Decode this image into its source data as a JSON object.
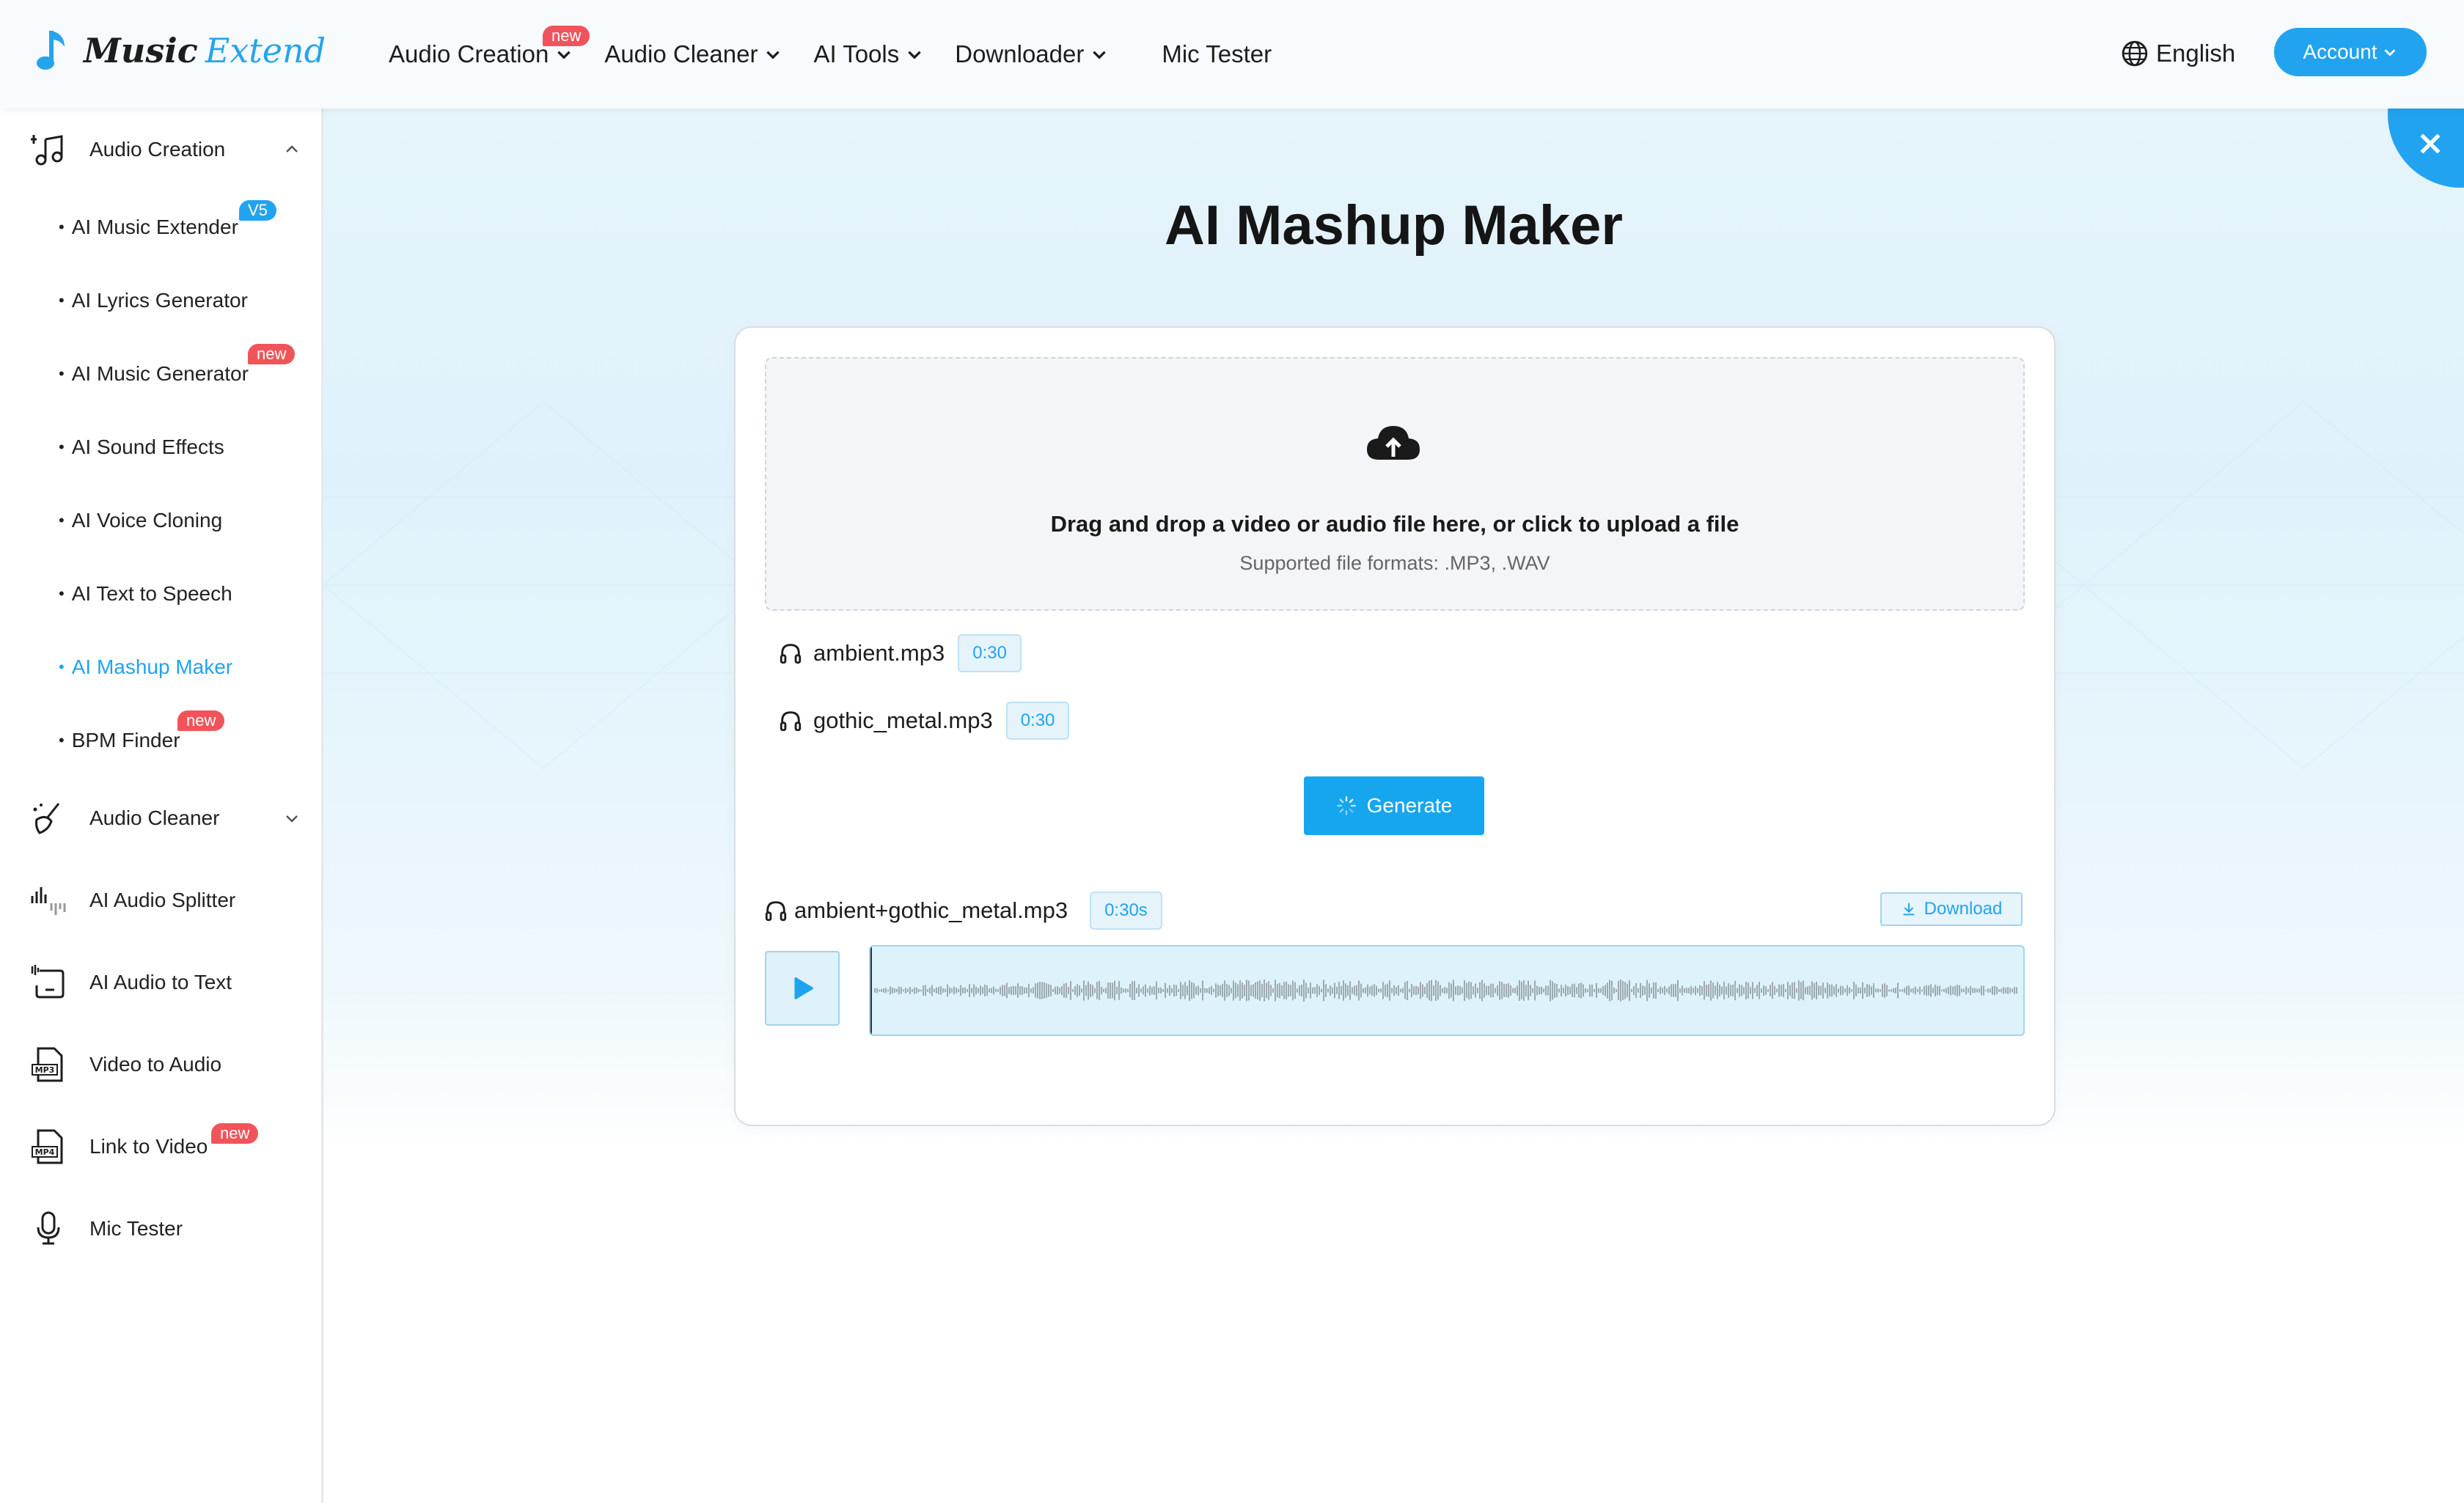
{
  "logo": {
    "word1": "Music",
    "word2": "Extend"
  },
  "nav": {
    "items": [
      {
        "label": "Audio Creation",
        "badge": "new"
      },
      {
        "label": "Audio Cleaner"
      },
      {
        "label": "AI Tools"
      },
      {
        "label": "Downloader"
      }
    ],
    "mic_tester": "Mic Tester",
    "language": "English",
    "account": "Account"
  },
  "sidebar": {
    "audio_creation": "Audio Creation",
    "sub_items": [
      {
        "label": "AI Music Extender",
        "badge": "V5"
      },
      {
        "label": "AI Lyrics Generator"
      },
      {
        "label": "AI Music Generator",
        "badge": "new"
      },
      {
        "label": "AI Sound Effects"
      },
      {
        "label": "AI Voice Cloning"
      },
      {
        "label": "AI Text to Speech"
      },
      {
        "label": "AI Mashup Maker",
        "active": true
      },
      {
        "label": "BPM Finder",
        "badge": "new"
      }
    ],
    "audio_cleaner": "Audio Cleaner",
    "sections": [
      {
        "label": "AI Audio Splitter",
        "icon": "waveform-icon"
      },
      {
        "label": "AI Audio to Text",
        "icon": "audio-to-text-icon"
      },
      {
        "label": "Video to Audio",
        "icon": "mp3-file-icon"
      },
      {
        "label": "Link to Video",
        "icon": "mp4-file-icon",
        "badge": "new"
      },
      {
        "label": "Mic Tester",
        "icon": "microphone-icon"
      }
    ]
  },
  "main": {
    "title": "AI Mashup Maker",
    "dropzone": {
      "title": "Drag and drop a video or audio file here, or click to upload a file",
      "formats": "Supported file formats:  .MP3, .WAV"
    },
    "files": [
      {
        "name": "ambient.mp3",
        "duration": "0:30"
      },
      {
        "name": "gothic_metal.mp3",
        "duration": "0:30"
      }
    ],
    "generate_label": "Generate",
    "result": {
      "name": "ambient+gothic_metal.mp3",
      "duration": "0:30s",
      "download_label": "Download"
    }
  },
  "colors": {
    "accent": "#22a3ef",
    "badge_red": "#f0545a",
    "text": "#1d1d1d"
  }
}
